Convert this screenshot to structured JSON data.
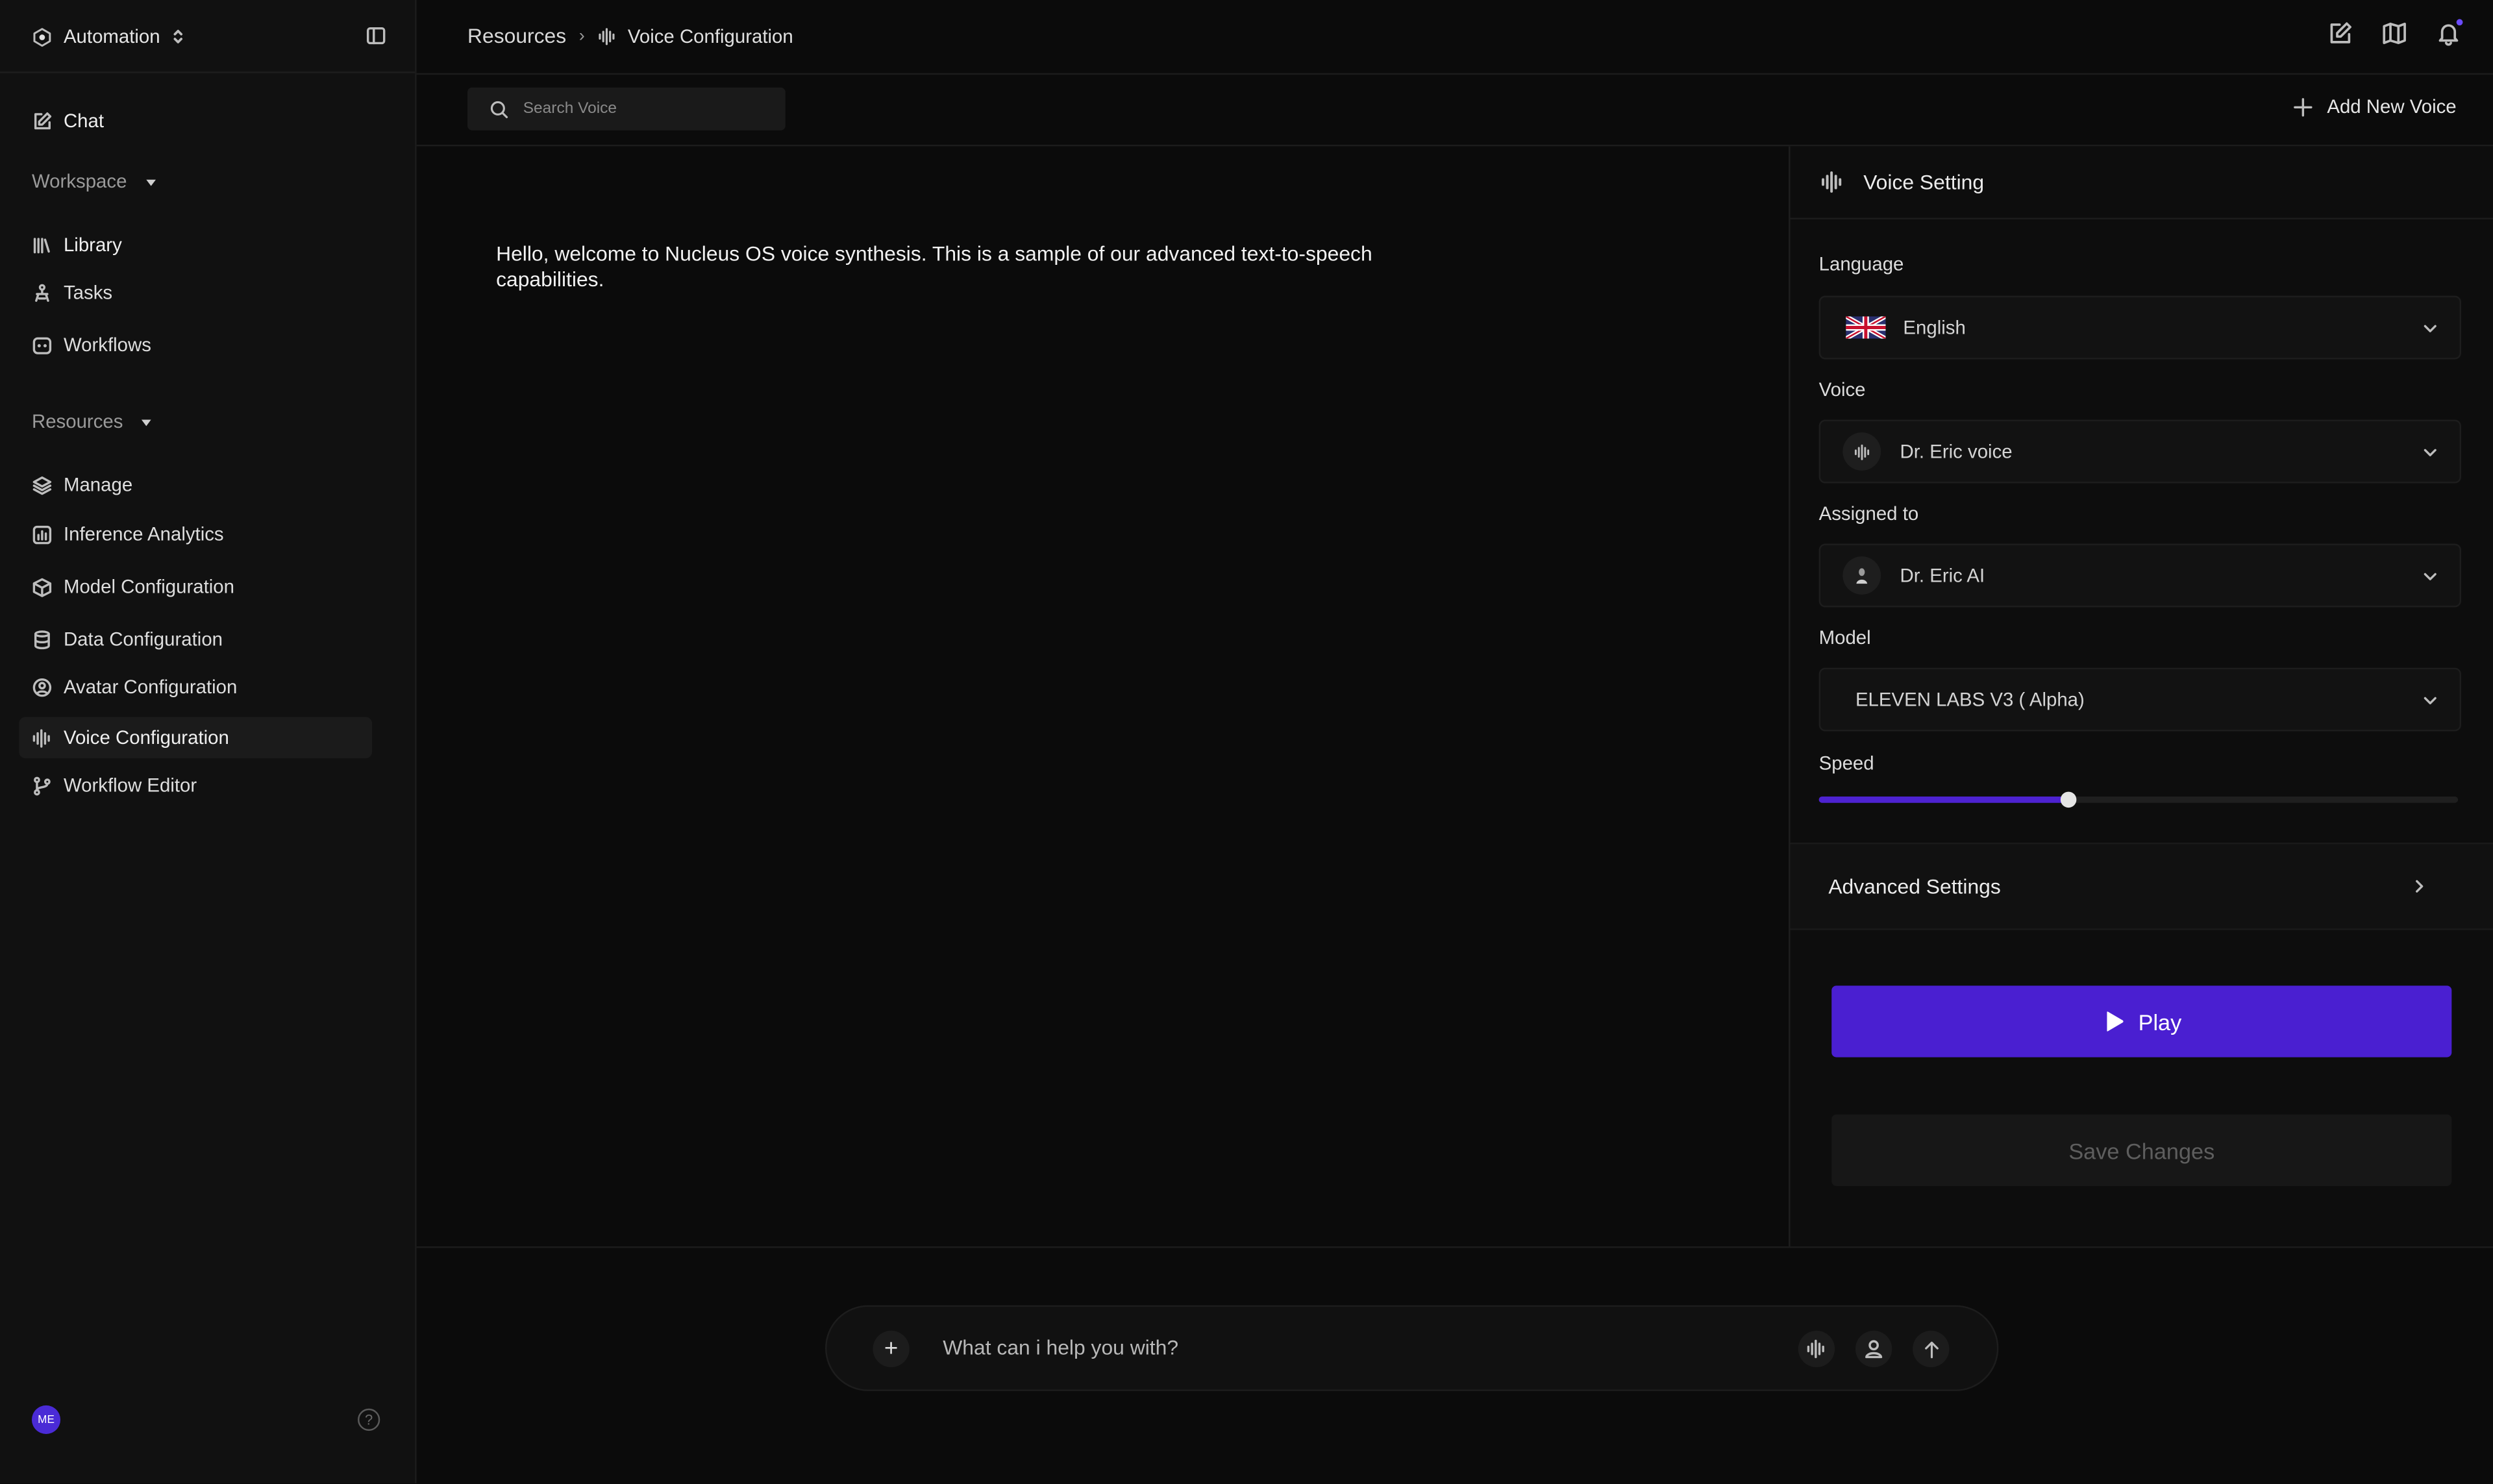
{
  "sidebar": {
    "org_name": "Automation",
    "chat_label": "Chat",
    "workspace": {
      "label": "Workspace",
      "items": [
        {
          "label": "Library",
          "icon": "library-icon"
        },
        {
          "label": "Tasks",
          "icon": "tasks-icon"
        },
        {
          "label": "Workflows",
          "icon": "workflows-icon"
        }
      ]
    },
    "resources": {
      "label": "Resources",
      "items": [
        {
          "label": "Manage",
          "icon": "layers-icon"
        },
        {
          "label": "Inference Analytics",
          "icon": "analytics-icon"
        },
        {
          "label": "Model Configuration",
          "icon": "cube-icon"
        },
        {
          "label": "Data Configuration",
          "icon": "database-icon"
        },
        {
          "label": "Avatar Configuration",
          "icon": "user-circle-icon"
        },
        {
          "label": "Voice Configuration",
          "icon": "waveform-icon",
          "active": true
        },
        {
          "label": "Workflow Editor",
          "icon": "git-branch-icon"
        }
      ]
    },
    "user_initials": "ME",
    "help_symbol": "?"
  },
  "header": {
    "breadcrumb_root": "Resources",
    "breadcrumb_separator": "›",
    "breadcrumb_current": "Voice Configuration"
  },
  "toolbar": {
    "search_placeholder": "Search Voice",
    "add_voice_label": "Add New Voice"
  },
  "main": {
    "sample_text": "Hello, welcome to Nucleus OS voice synthesis. This is a sample of our advanced text-to-speech capabilities."
  },
  "voice_setting": {
    "title": "Voice Setting",
    "language_label": "Language",
    "language_value": "English",
    "voice_label": "Voice",
    "voice_value": "Dr. Eric voice",
    "assigned_label": "Assigned to",
    "assigned_value": "Dr. Eric AI",
    "model_label": "Model",
    "model_value": "ELEVEN LABS V3 ( Alpha)",
    "speed_label": "Speed",
    "speed_fraction": 0.39,
    "advanced_label": "Advanced Settings",
    "play_label": "Play",
    "save_label": "Save Changes"
  },
  "chat": {
    "placeholder": "What can i help you with?",
    "plus_symbol": "+"
  },
  "colors": {
    "accent": "#4a1fd1",
    "background": "#0b0b0b",
    "sidebar": "#111111",
    "avatar": "#4a2bd6"
  }
}
